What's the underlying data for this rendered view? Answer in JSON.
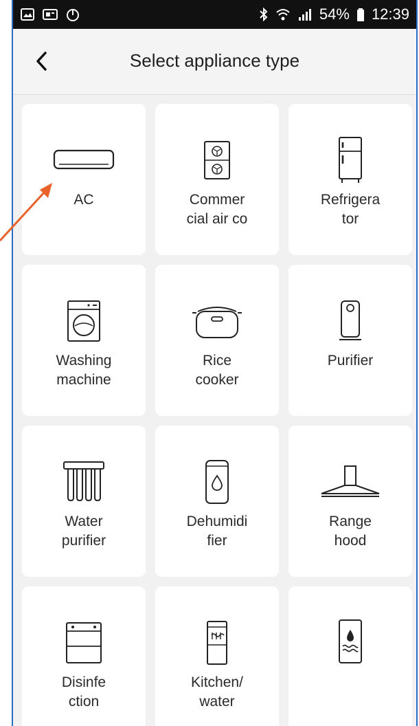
{
  "status_bar": {
    "left_icons": [
      "image-icon",
      "notification-icon",
      "sync-icon"
    ],
    "right_icons": [
      "bluetooth-icon",
      "wifi-icon",
      "signal-icon",
      "battery-icon"
    ],
    "battery": "54%",
    "time": "12:39"
  },
  "header": {
    "back_icon": "chevron-left-icon",
    "title": "Select appliance type"
  },
  "appliances": [
    {
      "label": "AC",
      "icon": "ac-icon"
    },
    {
      "label": "Commer\ncial air co",
      "icon": "commercial-air-icon"
    },
    {
      "label": "Refrigera\ntor",
      "icon": "refrigerator-icon"
    },
    {
      "label": "Washing\nmachine",
      "icon": "washing-machine-icon"
    },
    {
      "label": "Rice\ncooker",
      "icon": "rice-cooker-icon"
    },
    {
      "label": "Purifier",
      "icon": "purifier-icon"
    },
    {
      "label": "Water\npurifier",
      "icon": "water-purifier-icon"
    },
    {
      "label": "Dehumidi\nfier",
      "icon": "dehumidifier-icon"
    },
    {
      "label": "Range\nhood",
      "icon": "range-hood-icon"
    },
    {
      "label": "Disinfe\nction",
      "icon": "disinfection-icon"
    },
    {
      "label": "Kitchen/\nwater",
      "icon": "kitchen-water-icon"
    },
    {
      "label": "",
      "icon": "water-heater-icon"
    }
  ],
  "annotation_color": "#e8622a"
}
